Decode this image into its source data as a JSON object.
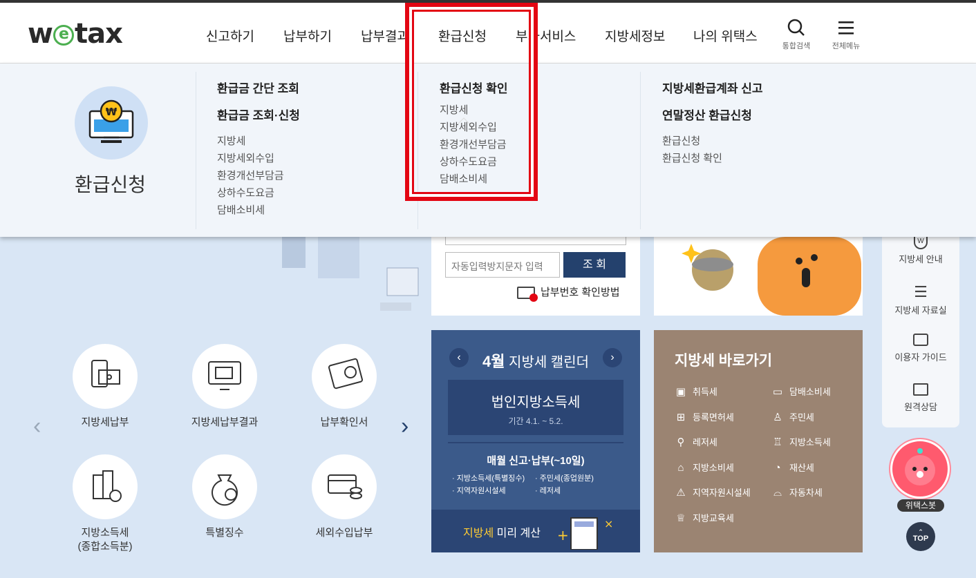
{
  "logo": {
    "pre": "w",
    "e": "e",
    "post": "tax"
  },
  "nav": {
    "items": [
      "신고하기",
      "납부하기",
      "납부결과",
      "환급신청",
      "부가서비스",
      "지방세정보",
      "나의 위택스"
    ],
    "search_label": "통합검색",
    "menu_label": "전체메뉴"
  },
  "mega": {
    "title": "환급신청",
    "col1": {
      "heading1": "환급금 간단 조회",
      "heading2": "환급금 조회·신청",
      "items": [
        "지방세",
        "지방세외수입",
        "환경개선부담금",
        "상하수도요금",
        "담배소비세"
      ]
    },
    "col2": {
      "heading": "환급신청 확인",
      "items": [
        "지방세",
        "지방세외수입",
        "환경개선부담금",
        "상하수도요금",
        "담배소비세"
      ]
    },
    "col3": {
      "heading1": "지방세환급계좌 신고",
      "heading2": "연말정산 환급신청",
      "items": [
        "환급신청",
        "환급신청 확인"
      ]
    }
  },
  "search": {
    "captcha_placeholder": "자동입력방지문자 입력",
    "submit": "조 회",
    "help": "납부번호 확인방법"
  },
  "quick": {
    "items": [
      "지방세납부",
      "지방세납부결과",
      "납부확인서",
      "지방소득세\n(종합소득분)",
      "특별징수",
      "세외수입납부"
    ]
  },
  "calendar": {
    "month": "4월",
    "title": "지방세 캘린더",
    "tax_name": "법인지방소득세",
    "period": "기간 4.1. ~ 5.2.",
    "monthly": "매월 신고·납부(~10일)",
    "list": [
      "· 지방소득세(특별징수)",
      "· 주민세(종업원분)",
      "· 지역자원시설세",
      "· 레저세"
    ],
    "calc_highlight": "지방세",
    "calc_rest": "미리 계산"
  },
  "shortcuts": {
    "title": "지방세 바로가기",
    "items": [
      "취득세",
      "담배소비세",
      "등록면허세",
      "주민세",
      "레저세",
      "지방소득세",
      "지방소비세",
      "재산세",
      "지역자원시설세",
      "자동차세",
      "지방교육세"
    ]
  },
  "side": {
    "items": [
      "지방세 안내",
      "지방세 자료실",
      "이용자 가이드",
      "원격상담"
    ],
    "bot": "위택스봇",
    "top": "TOP"
  },
  "colors": {
    "accent": "#e30613",
    "navy": "#24416d",
    "calendar": "#3b5a8a",
    "shortcut_bg": "#9b8472"
  }
}
